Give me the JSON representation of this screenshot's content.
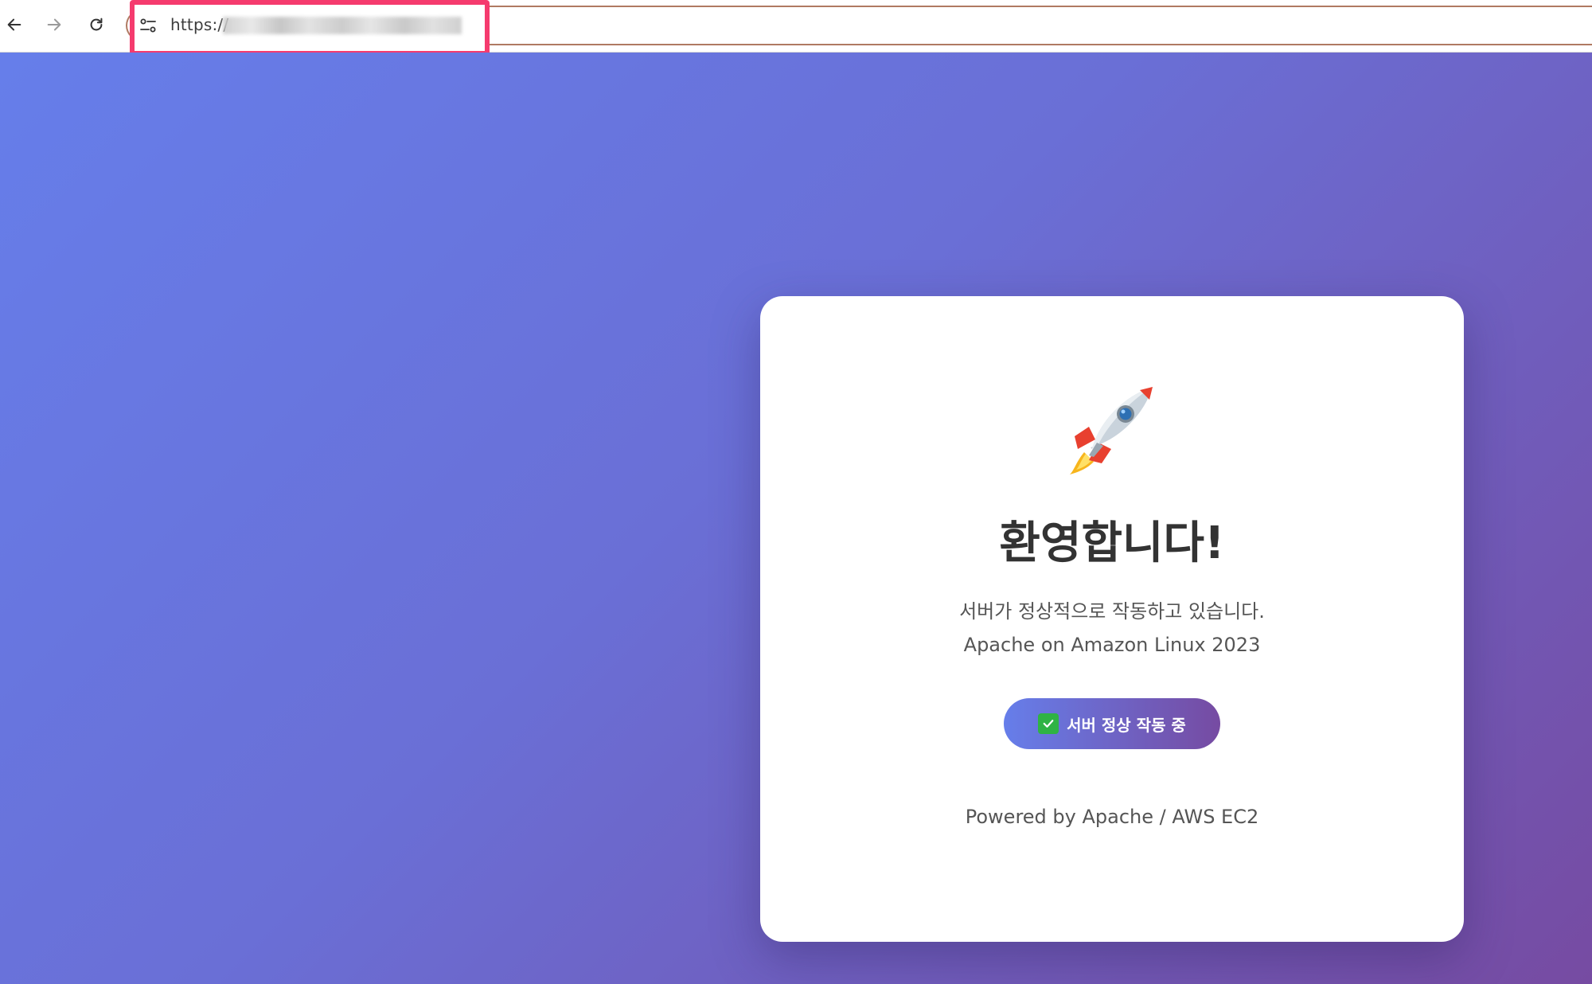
{
  "browser": {
    "url_prefix": "https://",
    "icons": {
      "back": "arrow-left-icon",
      "forward": "arrow-right-icon",
      "reload": "reload-icon",
      "site_info": "tune-icon"
    },
    "highlight_color": "#f53b6e"
  },
  "page": {
    "background": [
      "#667eea",
      "#764ba2"
    ],
    "hero_icon": "rocket-icon",
    "headline": "환영합니다!",
    "subtitle": "서버가 정상적으로 작동하고 있습니다.",
    "subtitle2": "Apache on Amazon Linux 2023",
    "status_label": "서버 정상 작동 중",
    "status_icon": "check-icon",
    "footer": "Powered by Apache / AWS EC2"
  }
}
